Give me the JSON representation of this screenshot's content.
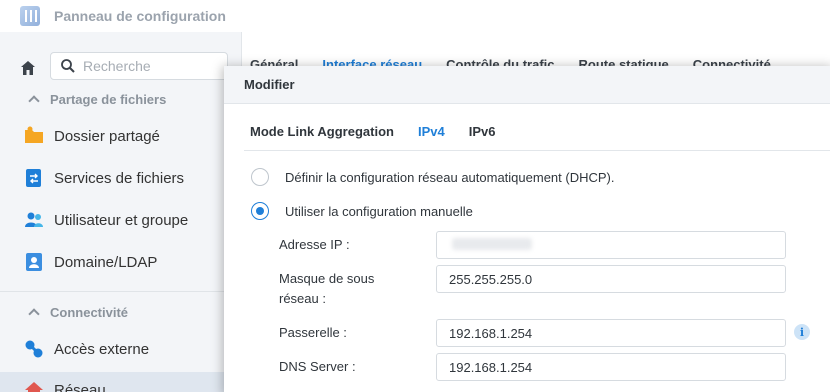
{
  "window": {
    "title": "Panneau de configuration"
  },
  "search": {
    "placeholder": "Recherche"
  },
  "sidebar": {
    "sections": [
      {
        "label": "Partage de fichiers"
      },
      {
        "label": "Connectivité"
      }
    ],
    "items": [
      {
        "label": "Dossier partagé",
        "icon": "folder-share-icon"
      },
      {
        "label": "Services de fichiers",
        "icon": "file-services-icon"
      },
      {
        "label": "Utilisateur et groupe",
        "icon": "user-group-icon"
      },
      {
        "label": "Domaine/LDAP",
        "icon": "domain-ldap-icon"
      },
      {
        "label": "Accès externe",
        "icon": "external-access-icon"
      },
      {
        "label": "Réseau",
        "icon": "network-icon"
      }
    ]
  },
  "tabs": [
    "Général",
    "Interface réseau",
    "Contrôle du trafic",
    "Route statique",
    "Connectivité"
  ],
  "active_tab": "Interface réseau",
  "modal": {
    "title": "Modifier",
    "tabs": [
      "Mode Link Aggregation",
      "IPv4",
      "IPv6"
    ],
    "active_tab": "IPv4",
    "radio_dhcp": "Définir la configuration réseau automatiquement (DHCP).",
    "radio_manual": "Utiliser la configuration manuelle",
    "selected_mode": "manual",
    "fields": {
      "ip_label": "Adresse IP :",
      "ip_value": "",
      "mask_label_1": "Masque de sous",
      "mask_label_2": "réseau :",
      "mask_value": "255.255.255.0",
      "gateway_label": "Passerelle :",
      "gateway_value": "192.168.1.254",
      "dns_label": "DNS Server :",
      "dns_value": "192.168.1.254"
    }
  },
  "colors": {
    "accent": "#1f7fd8",
    "sidebar_bg": "#f3f5f8"
  }
}
